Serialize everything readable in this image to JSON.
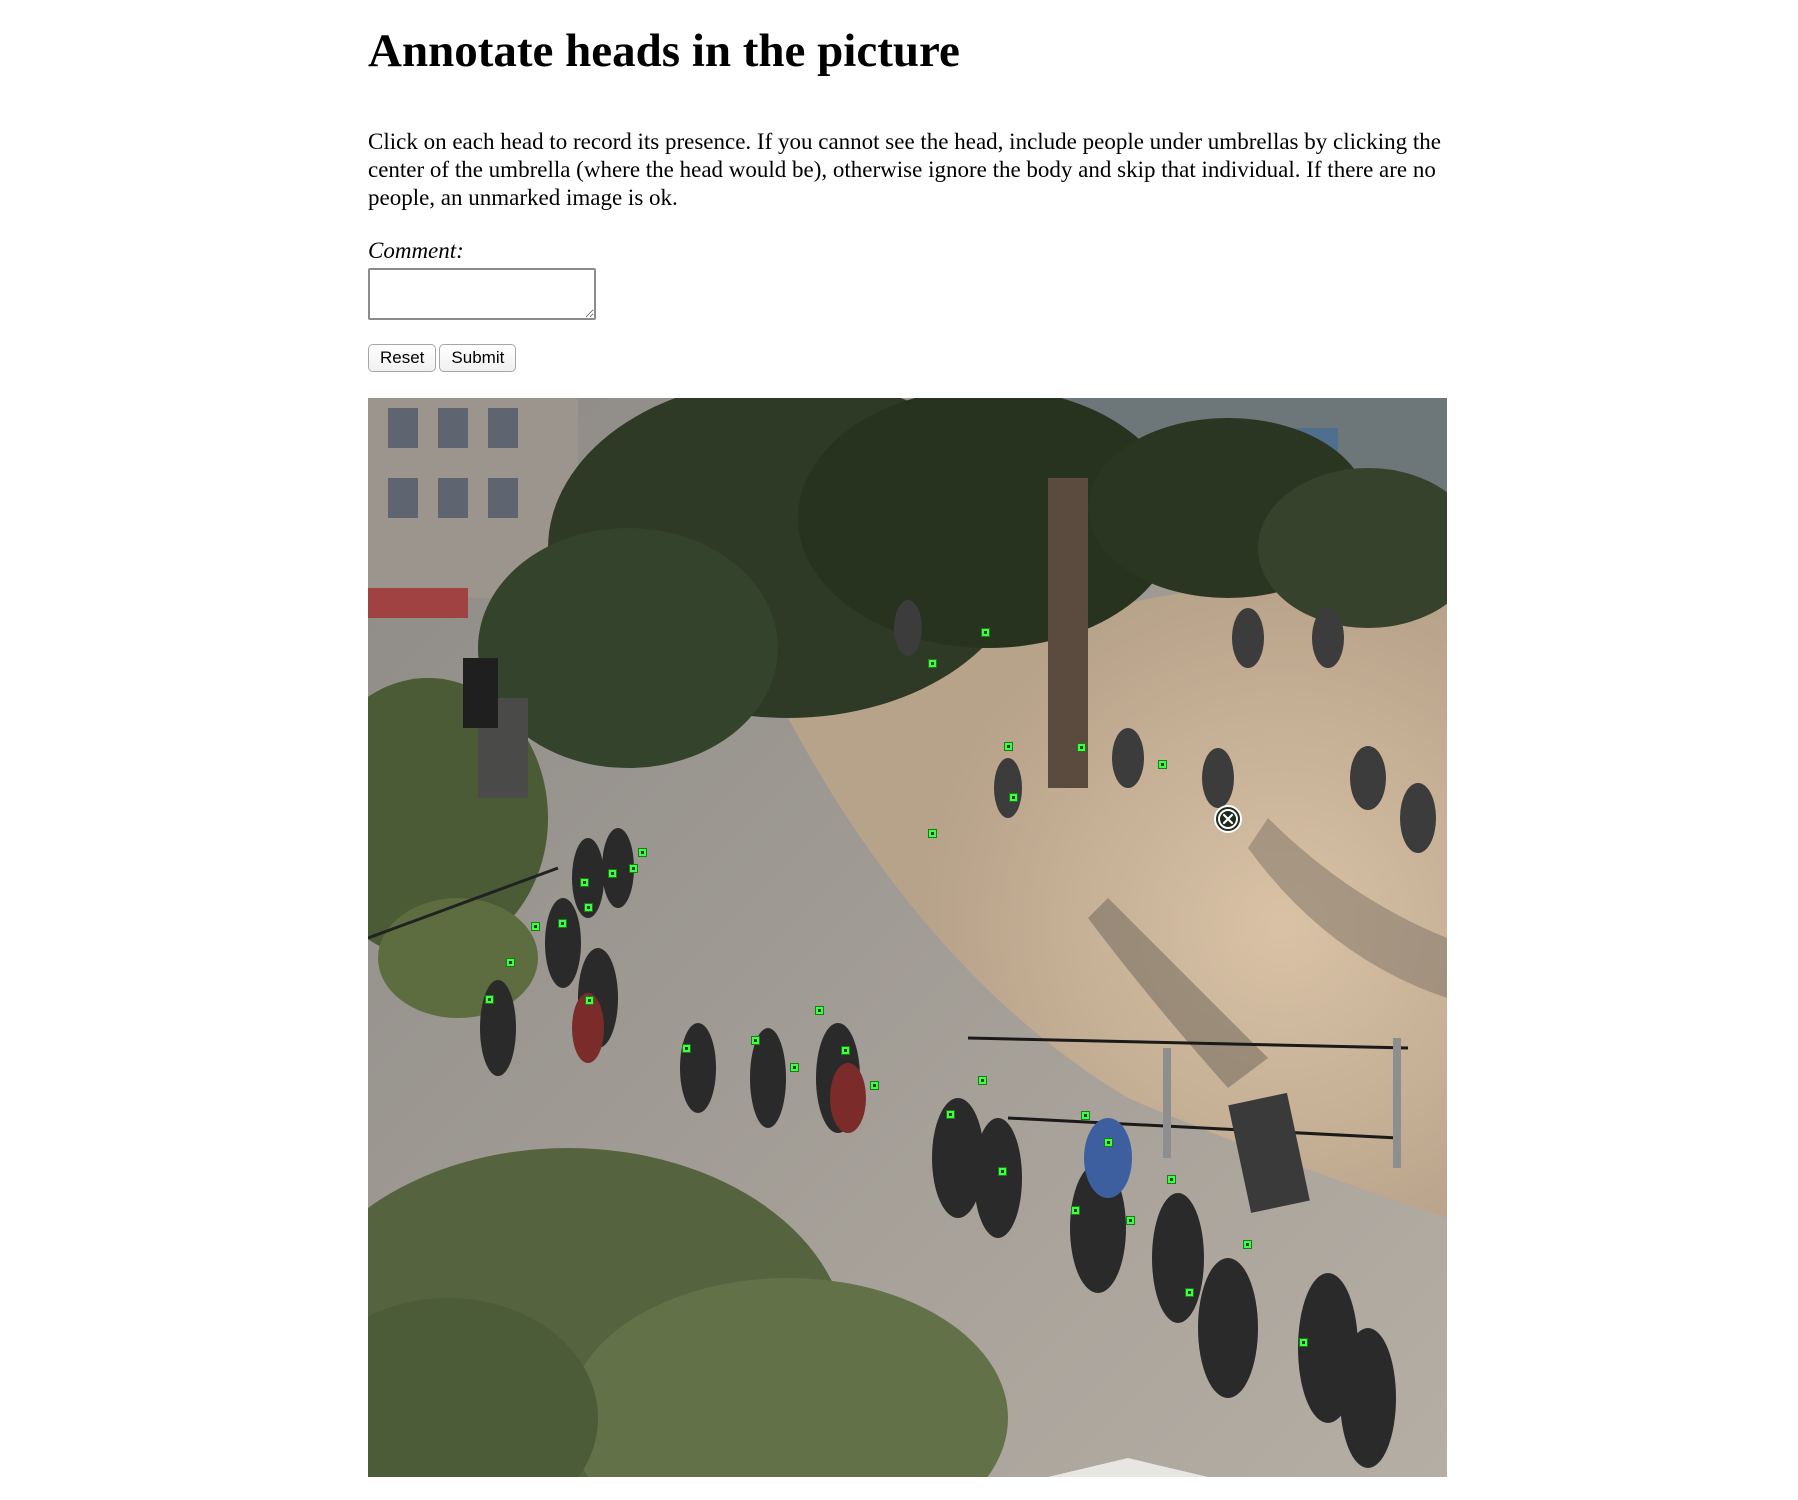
{
  "page": {
    "title": "Annotate heads in the picture",
    "instructions": "Click on each head to record its presence. If you cannot see the head, include people under umbrellas by clicking the center of the umbrella (where the head would be), otherwise ignore the body and skip that individual. If there are no people, an unmarked image is ok."
  },
  "form": {
    "comment_label": "Comment:",
    "comment_value": "",
    "reset_label": "Reset",
    "submit_label": "Submit"
  },
  "annotation": {
    "image_description_icon": "park-crowd-photo",
    "marker_color": "#3dff3d",
    "cursor_icon": "remove-x-cursor-icon"
  }
}
